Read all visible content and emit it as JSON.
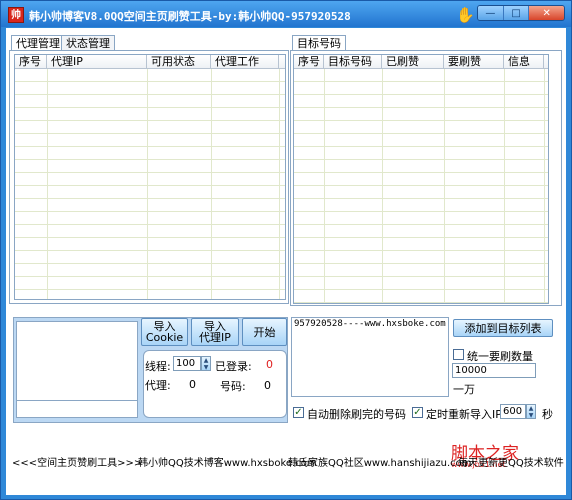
{
  "window": {
    "title": "韩小帅博客V8.0QQ空间主页刷赞工具-by:韩小帅QQ-957920528",
    "app_icon_glyph": "帅",
    "minimize": "—",
    "maximize": "□",
    "close": "✕"
  },
  "left_tabs": [
    "代理管理",
    "状态管理"
  ],
  "proxy_table": {
    "headers": [
      "序号",
      "代理IP",
      "可用状态",
      "代理工作"
    ]
  },
  "right_tab": "目标号码",
  "target_table": {
    "headers": [
      "序号",
      "目标号码",
      "已刷赞",
      "要刷赞",
      "信息"
    ]
  },
  "buttons": {
    "import_cookie": [
      "导入",
      "Cookie"
    ],
    "import_proxy": [
      "导入",
      "代理IP"
    ],
    "start": "开始",
    "add_target": "添加到目标列表"
  },
  "stats": {
    "threads_label": "线程:",
    "threads_value": "100",
    "logged_label": "已登录:",
    "logged_value": "0",
    "proxy_label": "代理:",
    "proxy_value": "0",
    "account_label": "号码:",
    "account_value": "0"
  },
  "target_input": "957920528----www.hxsboke.com",
  "options": {
    "unify_label": "统一要刷数量",
    "unify_checked": false,
    "count_value": "10000",
    "count_hint": "一万",
    "auto_delete_label": "自动删除刷完的号码",
    "auto_delete_checked": true,
    "reimport_label": "定时重新导入IP",
    "reimport_checked": true,
    "reimport_value": "600",
    "reimport_unit": "秒"
  },
  "statusbar": {
    "item1": "<<<空间主页赞刷工具>>>",
    "item2": "韩小帅QQ技术博客www.hxsboke.com",
    "item3": "韩氏家族QQ社区www.hanshijiazu.com",
    "item4": "每天更新更QQ技术软件"
  },
  "watermark": {
    "text": "脚本之家",
    "url": "www.jb51.net"
  },
  "colors": {
    "frame": "#2f88d8",
    "panel": "#bcd8f3",
    "red": "#e02020"
  }
}
